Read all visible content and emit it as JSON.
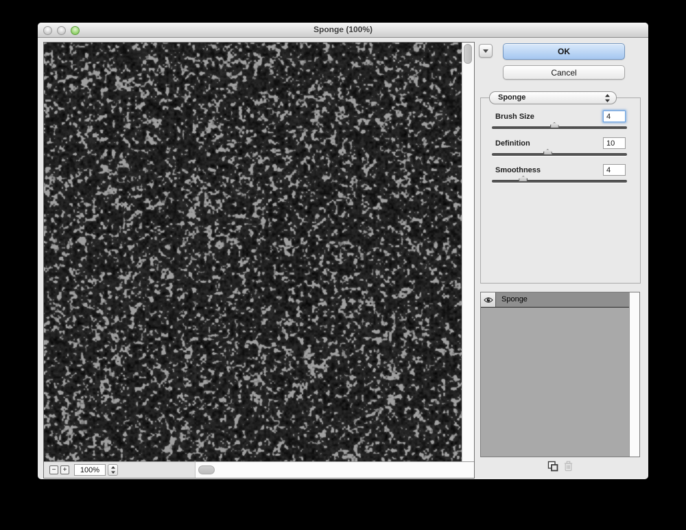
{
  "window": {
    "title": "Sponge (100%)"
  },
  "actions": {
    "ok": "OK",
    "cancel": "Cancel"
  },
  "filter_panel": {
    "selected_filter": "Sponge",
    "sliders": [
      {
        "label": "Brush Size",
        "value": "4",
        "percent": 46,
        "focused": true
      },
      {
        "label": "Definition",
        "value": "10",
        "percent": 41,
        "focused": false
      },
      {
        "label": "Smoothness",
        "value": "4",
        "percent": 23,
        "focused": false
      }
    ]
  },
  "effect_layers": {
    "rows": [
      {
        "name": "Sponge",
        "visible": true,
        "selected": true
      }
    ]
  },
  "statusbar": {
    "zoom_level": "100%",
    "zoom_out_label": "−",
    "zoom_in_label": "+"
  },
  "icons": {
    "traffic_lights": [
      "close-disabled",
      "minimize-disabled",
      "zoom-green"
    ],
    "disclosure": "chevron-down",
    "popup_stepper": "up-down-arrows",
    "visibility": "eye",
    "new_effect_layer": "new-layer-page",
    "delete_effect_layer": "trash",
    "zoom_out": "minus-box",
    "zoom_in": "plus-box"
  },
  "colors": {
    "ok_button_accent": "#a5c7f0",
    "focus_ring": "#6fa5e3",
    "selected_layer_row": "#8f8f8f",
    "layers_panel_bg": "#a9a9a9",
    "texture_base": "#0a0a0a",
    "texture_highlight": "#8c8c8c",
    "window_bg": "#e9e9e9"
  }
}
